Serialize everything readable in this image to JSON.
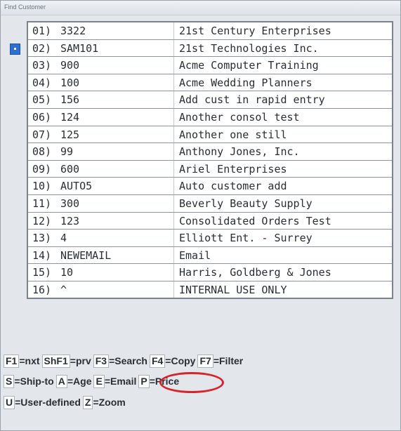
{
  "window": {
    "title": "Find Customer"
  },
  "selected_index": 1,
  "customers": [
    {
      "num": "01)",
      "code": "3322",
      "name": "21st Century Enterprises"
    },
    {
      "num": "02)",
      "code": "SAM101",
      "name": "21st Technologies Inc."
    },
    {
      "num": "03)",
      "code": "900",
      "name": "Acme Computer Training"
    },
    {
      "num": "04)",
      "code": "100",
      "name": "Acme Wedding Planners"
    },
    {
      "num": "05)",
      "code": "156",
      "name": "Add cust in rapid entry"
    },
    {
      "num": "06)",
      "code": "124",
      "name": "Another consol test"
    },
    {
      "num": "07)",
      "code": "125",
      "name": "Another one still"
    },
    {
      "num": "08)",
      "code": "99",
      "name": "Anthony Jones, Inc."
    },
    {
      "num": "09)",
      "code": "600",
      "name": "Ariel Enterprises"
    },
    {
      "num": "10)",
      "code": "AUTO5",
      "name": "Auto customer add"
    },
    {
      "num": "11)",
      "code": "300",
      "name": "Beverly Beauty Supply"
    },
    {
      "num": "12)",
      "code": "123",
      "name": "Consolidated Orders Test"
    },
    {
      "num": "13)",
      "code": "4",
      "name": "Elliott Ent. - Surrey"
    },
    {
      "num": "14)",
      "code": "NEWEMAIL",
      "name": "Email"
    },
    {
      "num": "15)",
      "code": "10",
      "name": "Harris, Goldberg & Jones"
    },
    {
      "num": "16)",
      "code": "^",
      "name": "INTERNAL USE ONLY"
    }
  ],
  "function_keys": [
    [
      {
        "key": "F1",
        "label": "=nxt"
      },
      {
        "key": "ShF1",
        "label": "=prv"
      },
      {
        "key": "F3",
        "label": "=Search"
      },
      {
        "key": "F4",
        "label": "=Copy"
      },
      {
        "key": "F7",
        "label": "=Filter"
      }
    ],
    [
      {
        "key": "S",
        "label": "=Ship-to"
      },
      {
        "key": "A",
        "label": "=Age"
      },
      {
        "key": "E",
        "label": "=Email"
      },
      {
        "key": "P",
        "label": "=Price"
      }
    ],
    [
      {
        "key": "U",
        "label": "=User-defined"
      },
      {
        "key": "Z",
        "label": "=Zoom"
      }
    ]
  ],
  "colors": {
    "selection_marker": "#2e6fd6",
    "highlight_circle": "#d9232a"
  }
}
